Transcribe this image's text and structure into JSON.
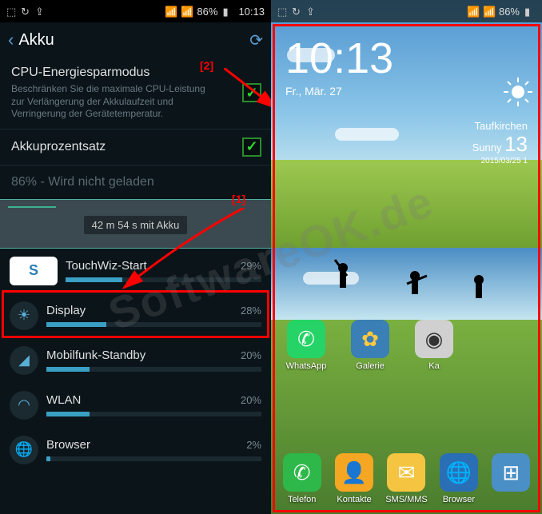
{
  "statusbar": {
    "battery_pct": "86%",
    "time": "10:13"
  },
  "left": {
    "title": "Akku",
    "settings": [
      {
        "title": "CPU-Energiesparmodus",
        "desc": "Beschränken Sie die maximale CPU-Leistung zur Verlängerung der Akkulaufzeit und Verringerung der Gerätetemperatur.",
        "checked": true
      },
      {
        "title": "Akkuprozentsatz",
        "desc": "",
        "checked": true
      }
    ],
    "status_line": "86% - Wird nicht geladen",
    "chart_time": "42 m 54 s mit Akku",
    "chart_data": {
      "type": "bar",
      "categories": [
        "TouchWiz-Start",
        "Display",
        "Mobilfunk-Standby",
        "WLAN",
        "Browser"
      ],
      "values": [
        29,
        28,
        20,
        20,
        2
      ],
      "title": "",
      "xlabel": "",
      "ylabel": "%",
      "ylim": [
        0,
        100
      ]
    },
    "items": [
      {
        "name": "TouchWiz-Start",
        "pct": "29%",
        "bar": 29
      },
      {
        "name": "Display",
        "pct": "28%",
        "bar": 28
      },
      {
        "name": "Mobilfunk-Standby",
        "pct": "20%",
        "bar": 20
      },
      {
        "name": "WLAN",
        "pct": "20%",
        "bar": 20
      },
      {
        "name": "Browser",
        "pct": "2%",
        "bar": 2
      }
    ]
  },
  "right": {
    "clock_time": "10:13",
    "clock_date": "Fr., Mär. 27",
    "weather_place": "Taufkirchen",
    "weather_cond": "Sunny",
    "weather_temp": "13",
    "weather_date": "2015/03/25 1",
    "apps_row1": [
      {
        "label": "WhatsApp",
        "color": "#25d366",
        "glyph": "✆"
      },
      {
        "label": "Galerie",
        "color": "#3a7fb5",
        "glyph": "✿"
      },
      {
        "label": "Ka",
        "color": "#d0d0d0",
        "glyph": "◉"
      }
    ],
    "dock": [
      {
        "label": "Telefon",
        "color": "#2eb84a",
        "glyph": "✆"
      },
      {
        "label": "Kontakte",
        "color": "#f5a623",
        "glyph": "👤"
      },
      {
        "label": "SMS/MMS",
        "color": "#f5c542",
        "glyph": "✉"
      },
      {
        "label": "Browser",
        "color": "#2a6fb5",
        "glyph": "🌐"
      },
      {
        "label": "",
        "color": "#4a8fc5",
        "glyph": "⊞"
      }
    ]
  },
  "annotations": {
    "label1": "[1]",
    "label2": "[2]"
  },
  "watermark": "SoftwareOK.de"
}
